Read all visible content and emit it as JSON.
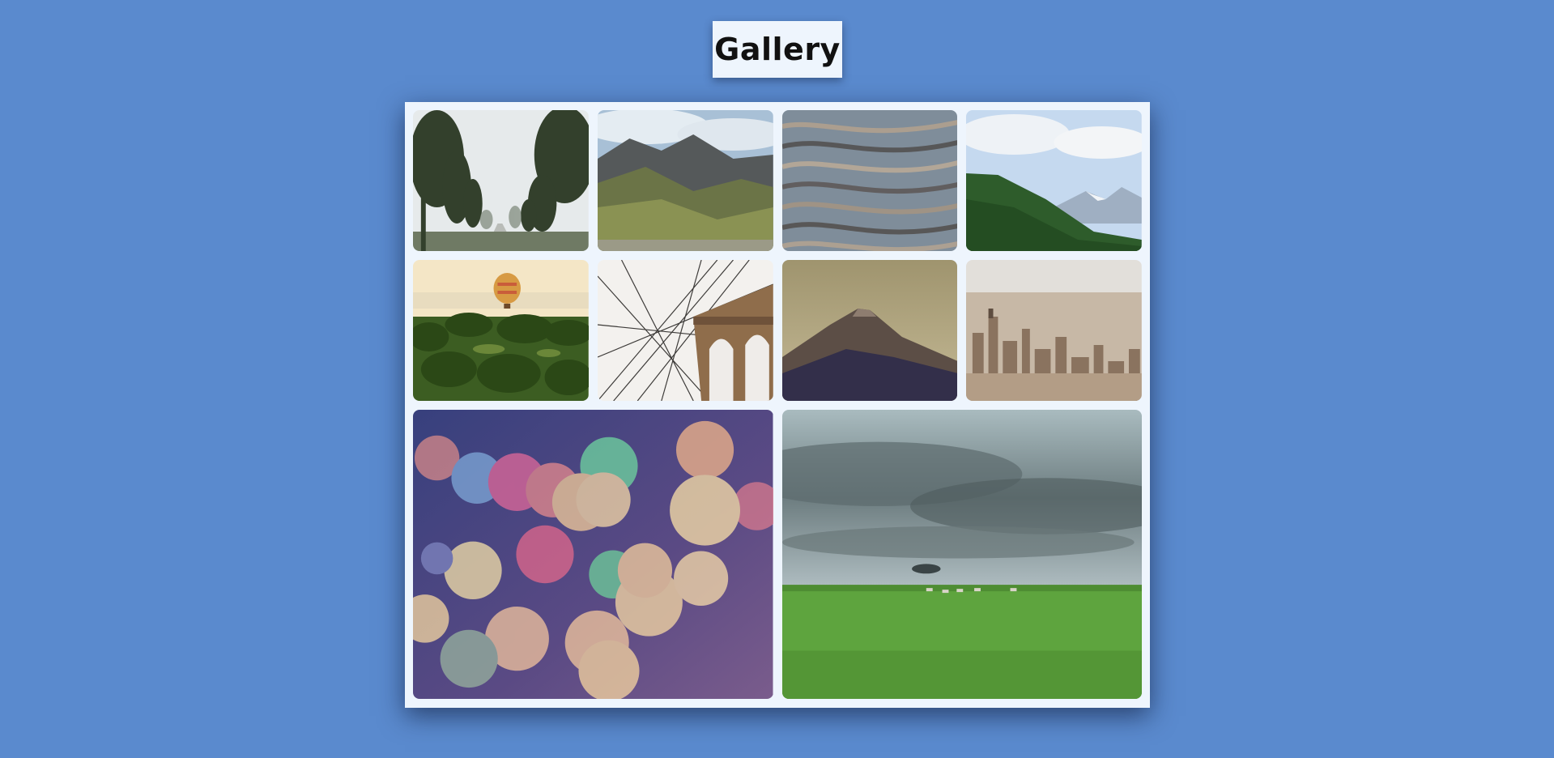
{
  "header": {
    "title": "Gallery"
  },
  "gallery": {
    "images": [
      {
        "name": "foggy-tree-road",
        "colors": [
          "#e7ebec",
          "#38452f",
          "#9aa69a"
        ]
      },
      {
        "name": "cloudy-mountain-valley",
        "colors": [
          "#a9bfd3",
          "#59605f",
          "#7e8c47"
        ]
      },
      {
        "name": "rippled-water",
        "colors": [
          "#8d9aa5",
          "#4e4a48",
          "#b6a18b"
        ]
      },
      {
        "name": "forested-mountain-ridge",
        "colors": [
          "#c9dbef",
          "#2d5b2a",
          "#eef2f5"
        ]
      },
      {
        "name": "hot-air-balloon-palms",
        "colors": [
          "#f5e7c6",
          "#34521d",
          "#d8a04a"
        ]
      },
      {
        "name": "bridge-cables",
        "colors": [
          "#f4f2f0",
          "#8a6a4a",
          "#3b3b3b"
        ]
      },
      {
        "name": "misty-volcano",
        "colors": [
          "#b1a582",
          "#2e2e48",
          "#6a5a4d"
        ]
      },
      {
        "name": "hazy-city-skyline",
        "colors": [
          "#e3e0da",
          "#8c7662",
          "#b9a892"
        ]
      },
      {
        "name": "bokeh-lights",
        "colors": [
          "#3a3f7c",
          "#f7d69a",
          "#e06b8b"
        ]
      },
      {
        "name": "storm-over-grassland",
        "colors": [
          "#8fa0a5",
          "#5aa33d",
          "#394648"
        ]
      }
    ]
  }
}
